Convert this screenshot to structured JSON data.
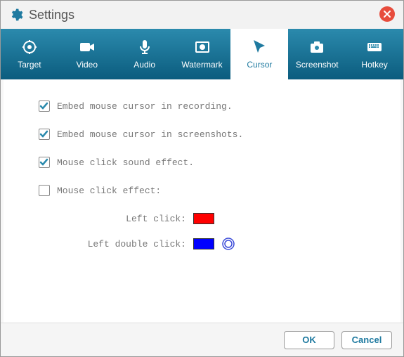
{
  "title": "Settings",
  "tabs": [
    {
      "label": "Target"
    },
    {
      "label": "Video"
    },
    {
      "label": "Audio"
    },
    {
      "label": "Watermark"
    },
    {
      "label": "Cursor"
    },
    {
      "label": "Screenshot"
    },
    {
      "label": "Hotkey"
    }
  ],
  "active_tab": "Cursor",
  "options": {
    "embed_recording": "Embed mouse cursor in recording.",
    "embed_screenshots": "Embed mouse cursor in screenshots.",
    "click_sound": "Mouse click sound effect.",
    "click_effect": "Mouse click effect:"
  },
  "click_colors": {
    "left_label": "Left click:",
    "left_color": "#ff0000",
    "left_double_label": "Left double click:",
    "left_double_color": "#0000ff"
  },
  "buttons": {
    "ok": "OK",
    "cancel": "Cancel"
  }
}
